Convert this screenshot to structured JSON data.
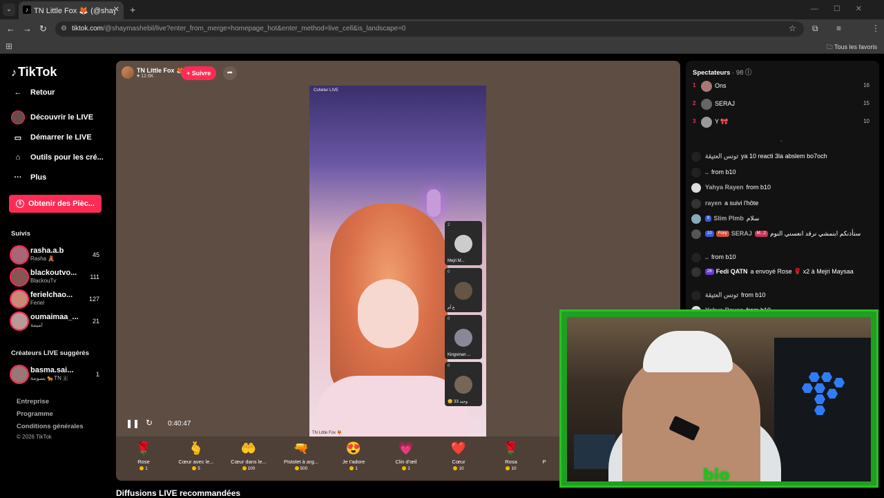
{
  "browser": {
    "tab_title": "TN Little Fox 🦊 (@shayma",
    "url_host": "tiktok.com",
    "url_path": "/@shaymashebil/live?enter_from_merge=homepage_hot&enter_method=live_cell&is_landscape=0",
    "bookmarks_label": "Tous les favoris"
  },
  "sidebar": {
    "brand": "TikTok",
    "back": "Retour",
    "nav": [
      "Découvrir le LIVE",
      "Démarrer le LIVE",
      "Outils pour les cré...",
      "Plus"
    ],
    "coins_button": "Obtenir des Pièc...",
    "followed_title": "Suivis",
    "followed": [
      {
        "name": "rasha.a.b",
        "sub": "Rasha 🧸",
        "count": "45"
      },
      {
        "name": "blackoutvo...",
        "sub": "BlackouTv",
        "count": "111"
      },
      {
        "name": "ferielchao...",
        "sub": "Feriel",
        "count": "127"
      },
      {
        "name": "oumaimaa_...",
        "sub": "اميمة",
        "count": "21"
      }
    ],
    "suggested_title": "Créateurs LIVE suggérés",
    "suggested": [
      {
        "name": "basma.sai...",
        "sub": "بسومة 🐆TN 🇦",
        "count": "1"
      }
    ],
    "footer": [
      "Entreprise",
      "Programme",
      "Conditions générales"
    ],
    "copyright": "© 2026 TikTok"
  },
  "player": {
    "host_name": "TN Little Fox 🦊",
    "host_likes": "♥ 12.6K",
    "follow_label": "+ Suivre",
    "timer": "0:40:47",
    "video_tag": "Cohéter LIVE",
    "video_tag_bottom": "TN Little Fox 🦊",
    "guests": [
      {
        "count": "2",
        "name": "Mejri M..."
      },
      {
        "count": "0",
        "name": "ع آم"
      },
      {
        "count": "0",
        "name": "Kingsman ..."
      },
      {
        "count": "0",
        "name": "😊 وحيد 33"
      }
    ],
    "gifts": [
      {
        "name": "Rose",
        "price": "1",
        "icon": "🌹"
      },
      {
        "name": "Cœur avec le...",
        "price": "5",
        "icon": "🫰"
      },
      {
        "name": "Cœur dans le...",
        "price": "100",
        "icon": "🤲"
      },
      {
        "name": "Pistolet à arg...",
        "price": "500",
        "icon": "🔫"
      },
      {
        "name": "Je t'adore",
        "price": "1",
        "icon": "😍"
      },
      {
        "name": "Clin d'œil",
        "price": "1",
        "icon": "💗"
      },
      {
        "name": "Cœur",
        "price": "10",
        "icon": "❤️"
      },
      {
        "name": "Rosa",
        "price": "10",
        "icon": "🌹"
      }
    ],
    "gift_partial": "P"
  },
  "recommended_title": "Diffusions LIVE recommandées",
  "chat": {
    "spectators_label": "Spectateurs",
    "spectators_count": "· 98",
    "ranking": [
      {
        "rank": "1",
        "name": "Ons",
        "score": "16"
      },
      {
        "rank": "2",
        "name": "SERAJ",
        "score": "15"
      },
      {
        "rank": "3",
        "name": "Y 🎀",
        "score": "10"
      }
    ],
    "messages": [
      {
        "user": "تونس العتيقة",
        "text": "ya 10 reacti 3la abslem bo7och"
      },
      {
        "user": "..",
        "text": "from b10"
      },
      {
        "user": "Yahya Rayen",
        "text": "from b10"
      },
      {
        "user": "rayen",
        "text": "a suivi l'hôte"
      },
      {
        "user": "Slim Plmb",
        "text": "سلام"
      },
      {
        "user": "SERAJ",
        "text": "ستأذنكم ابنمشي نرقد انعسني النوم"
      },
      {
        "user": "..",
        "text": "from b10"
      },
      {
        "user": "Fedi QATN",
        "text": "a envoyé Rose 🌹 x2 à Mejri Maysaa"
      },
      {
        "user": "تونس العتيقة",
        "text": "from b10"
      },
      {
        "user": "Yahya Rayen",
        "text": "from b10"
      }
    ],
    "badges": {
      "slim": "9",
      "seraj_lvl": "10",
      "seraj_fan": "Foxy",
      "seraj_gift": "M...2",
      "fedi": "26"
    }
  },
  "webcam": {
    "logo_text": "bio"
  }
}
